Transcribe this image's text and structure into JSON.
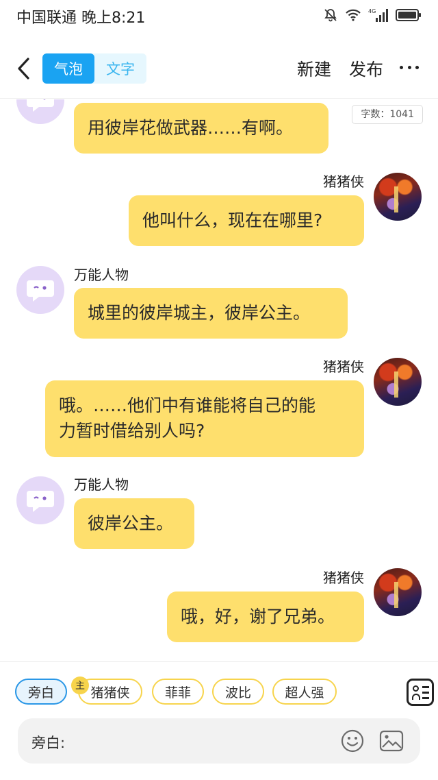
{
  "status_bar": {
    "carrier_time": "中国联通 晚上8:21",
    "network": "4G"
  },
  "header": {
    "tabs": [
      {
        "label": "气泡",
        "active": true
      },
      {
        "label": "文字",
        "active": false
      }
    ],
    "new_label": "新建",
    "publish_label": "发布"
  },
  "chat": {
    "word_count": "字数：1041",
    "messages": [
      {
        "side": "left",
        "name": "",
        "text": "用彼岸花做武器……有啊。"
      },
      {
        "side": "right",
        "name": "猪猪侠",
        "text": "他叫什么，现在在哪里?"
      },
      {
        "side": "left",
        "name": "万能人物",
        "text": "城里的彼岸城主，彼岸公主。"
      },
      {
        "side": "right",
        "name": "猪猪侠",
        "text_line1": "哦。……他们中有谁能将自己的能",
        "text_line2": "力暂时借给别人吗?"
      },
      {
        "side": "left",
        "name": "万能人物",
        "text": "彼岸公主。"
      },
      {
        "side": "right",
        "name": "猪猪侠",
        "text": "哦，好，谢了兄弟。"
      }
    ]
  },
  "roles": {
    "chips": [
      "旁白",
      "猪猪侠",
      "菲菲",
      "波比",
      "超人强"
    ],
    "main_badge": "主"
  },
  "input": {
    "label": "旁白:"
  },
  "colors": {
    "bubble": "#fedf6d",
    "accent_blue": "#1aa3f2",
    "chip_border": "#f7d44c",
    "bot_avatar": "#e5d9f8"
  }
}
